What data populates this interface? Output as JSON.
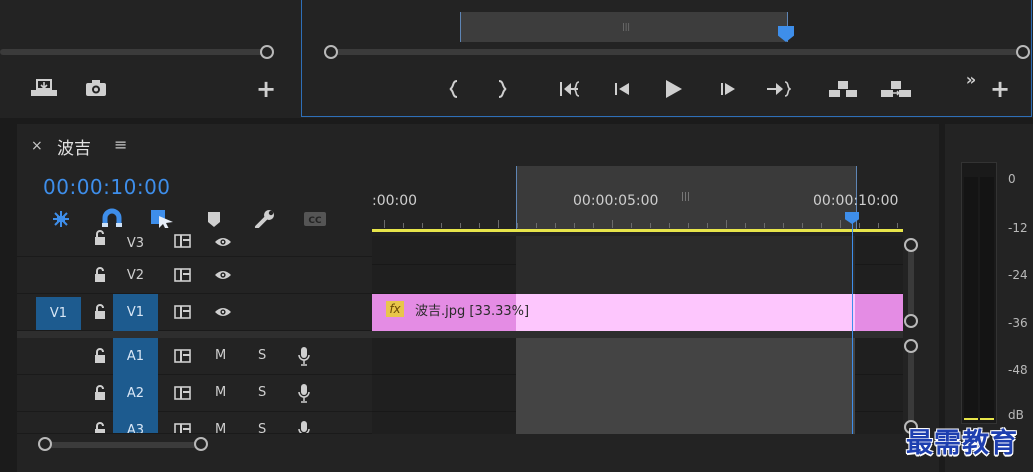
{
  "sequence": {
    "tab_title": "波吉",
    "tab_close": "×",
    "tab_menu": "≡",
    "timecode": "00:00:10:00"
  },
  "ruler": {
    "labels": [
      ":00:00",
      "00:00:05:00",
      "00:00:10:00"
    ]
  },
  "tracks": {
    "video": [
      {
        "name": "V3"
      },
      {
        "name": "V2"
      },
      {
        "name": "V1",
        "source_patch": "V1"
      }
    ],
    "audio": [
      {
        "name": "A1",
        "mute": "M",
        "solo": "S"
      },
      {
        "name": "A2",
        "mute": "M",
        "solo": "S"
      },
      {
        "name": "A3",
        "mute": "M",
        "solo": "S"
      }
    ]
  },
  "clip": {
    "fx_badge": "fx",
    "label": "波吉.jpg [33.33%]"
  },
  "meter": {
    "db_labels": [
      "0",
      "-12",
      "-24",
      "-36",
      "-48",
      "dB"
    ]
  },
  "watermark": "最需教育",
  "colors": {
    "accent": "#3e8eea",
    "selected_track": "#1d5b8f",
    "clip": "#fdc6fd",
    "work_area": "#e7e54a"
  }
}
